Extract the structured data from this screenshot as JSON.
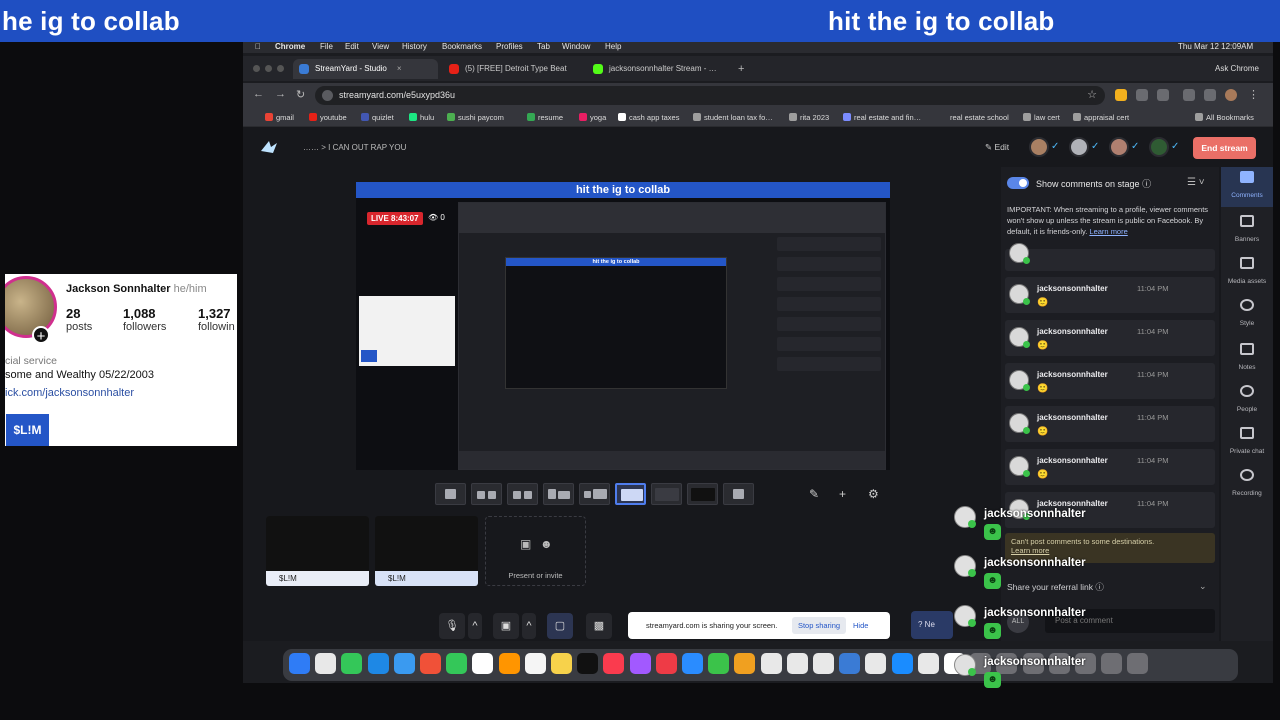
{
  "overlay": {
    "banner_left": "he ig to collab",
    "banner_right": "hit the ig to collab",
    "ig_card": {
      "name": "Jackson Sonnhalter",
      "pronouns": "he/him",
      "posts_count": "28",
      "posts_label": "posts",
      "followers_count": "1,088",
      "followers_label": "followers",
      "following_count": "1,327",
      "following_label": "followin",
      "category": "cial service",
      "bio": "some and Wealthy 05/22/2003",
      "link": "ick.com/jacksonsonnhalter",
      "button": "$L!M"
    },
    "chat": [
      {
        "name": "jacksonsonnhalter"
      },
      {
        "name": "jacksonsonnhalter"
      },
      {
        "name": "jacksonsonnhalter"
      },
      {
        "name": "jacksonsonnhalter"
      }
    ]
  },
  "menubar": {
    "app": "Chrome",
    "items": [
      "File",
      "Edit",
      "View",
      "History",
      "Bookmarks",
      "Profiles",
      "Tab",
      "Window",
      "Help"
    ],
    "datetime": "Thu Mar 12  12:09AM"
  },
  "browser": {
    "tabs": [
      {
        "title": "StreamYard - Studio",
        "icon_color": "#3a7bd5"
      },
      {
        "title": "(5) [FREE] Detroit Type Beat",
        "icon_color": "#e62117"
      },
      {
        "title": "jacksonsonnhalter Stream - …",
        "icon_color": "#53fc18"
      }
    ],
    "new_tab": "+",
    "ask_chrome": "Ask Chrome",
    "url": "streamyard.com/e5uxypd36u",
    "bookmarks": [
      {
        "label": "gmail",
        "color": "#ea4335"
      },
      {
        "label": "youtube",
        "color": "#e62117"
      },
      {
        "label": "quizlet",
        "color": "#4257b2"
      },
      {
        "label": "hulu",
        "color": "#1ce783"
      },
      {
        "label": "sushi paycom",
        "color": "#4caf50"
      },
      {
        "label": "resume",
        "color": "#34a853"
      },
      {
        "label": "yoga",
        "color": "#e91e63"
      },
      {
        "label": "cash app taxes",
        "color": "#ffffff"
      },
      {
        "label": "student loan tax fo…",
        "color": "#9e9e9e"
      },
      {
        "label": "rita 2023",
        "color": "#9e9e9e"
      },
      {
        "label": "real estate and fin…",
        "color": "#7b8cff"
      },
      {
        "label": "real estate school",
        "color": "#9e9e9e"
      },
      {
        "label": "law cert",
        "color": "#9e9e9e"
      },
      {
        "label": "appraisal cert",
        "color": "#9e9e9e"
      },
      {
        "label": "All Bookmarks",
        "color": "#9e9e9e"
      }
    ]
  },
  "studio": {
    "breadcrumb": "……  >   I CAN OUT RAP YOU",
    "edit_label": "Edit",
    "end_stream": "End stream",
    "stage_banner": "hit the ig to collab",
    "live_timer": "LIVE 8:43:07",
    "viewer_count": "0",
    "nested_banner": "hit the ig to collab",
    "thumbs": [
      {
        "label": "$L!M"
      },
      {
        "label": "$L!M"
      }
    ],
    "present_label": "Present or invite",
    "share_text": "streamyard.com is sharing your screen.",
    "stop_sharing": "Stop sharing",
    "hide": "Hide",
    "help_label": "Ne"
  },
  "comments_panel": {
    "toggle_label": "Show comments on stage",
    "notice": "IMPORTANT: When streaming to a profile, viewer comments won't show up unless the stream is public on Facebook. By default, it is friends-only.",
    "notice_link": "Learn more",
    "comments": [
      {
        "name": "jacksonsonnhalter",
        "time": "11:04 PM"
      },
      {
        "name": "jacksonsonnhalter",
        "time": "11:04 PM"
      },
      {
        "name": "jacksonsonnhalter",
        "time": "11:04 PM"
      },
      {
        "name": "jacksonsonnhalter",
        "time": "11:04 PM"
      },
      {
        "name": "jacksonsonnhalter",
        "time": "11:04 PM"
      },
      {
        "name": "jacksonsonnhalter",
        "time": "11:04 PM"
      }
    ],
    "cant_post": "Can't post comments to some destinations.",
    "cant_post_link": "Learn more",
    "referral": "Share your referral link",
    "post_all": "ALL",
    "post_placeholder": "Post a comment"
  },
  "rail": [
    {
      "label": "Comments"
    },
    {
      "label": "Banners"
    },
    {
      "label": "Media assets"
    },
    {
      "label": "Style"
    },
    {
      "label": "Notes"
    },
    {
      "label": "People"
    },
    {
      "label": "Private chat"
    },
    {
      "label": "Recording"
    }
  ],
  "dock": {
    "app_colors": [
      "#2f7cf6",
      "#e8e8e8",
      "#34c759",
      "#1e88e5",
      "#3a9af0",
      "#f05138",
      "#34c759",
      "#ffffff",
      "#ff9500",
      "#f5f5f5",
      "#f7d24b",
      "#111111",
      "#fa3b4e",
      "#a259ff",
      "#ee3b46",
      "#2a8cff",
      "#3bc34a",
      "#f0a020",
      "#e8e8e8",
      "#e8e8e8",
      "#e8e8e8",
      "#3a7bd5",
      "#e8e8e8",
      "#1a8cff",
      "#e8e8e8",
      "#ffffff",
      "#6e6e73",
      "#6e6e73",
      "#6e6e73",
      "#6e6e73",
      "#6e6e73",
      "#6e6e73",
      "#6e6e73"
    ]
  }
}
